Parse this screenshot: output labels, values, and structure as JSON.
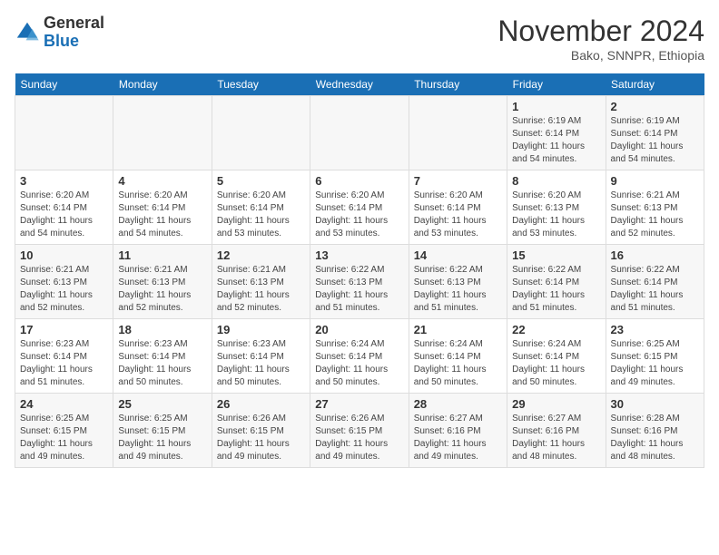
{
  "header": {
    "logo_line1": "General",
    "logo_line2": "Blue",
    "month": "November 2024",
    "location": "Bako, SNNPR, Ethiopia"
  },
  "weekdays": [
    "Sunday",
    "Monday",
    "Tuesday",
    "Wednesday",
    "Thursday",
    "Friday",
    "Saturday"
  ],
  "weeks": [
    [
      {
        "day": "",
        "info": ""
      },
      {
        "day": "",
        "info": ""
      },
      {
        "day": "",
        "info": ""
      },
      {
        "day": "",
        "info": ""
      },
      {
        "day": "",
        "info": ""
      },
      {
        "day": "1",
        "info": "Sunrise: 6:19 AM\nSunset: 6:14 PM\nDaylight: 11 hours\nand 54 minutes."
      },
      {
        "day": "2",
        "info": "Sunrise: 6:19 AM\nSunset: 6:14 PM\nDaylight: 11 hours\nand 54 minutes."
      }
    ],
    [
      {
        "day": "3",
        "info": "Sunrise: 6:20 AM\nSunset: 6:14 PM\nDaylight: 11 hours\nand 54 minutes."
      },
      {
        "day": "4",
        "info": "Sunrise: 6:20 AM\nSunset: 6:14 PM\nDaylight: 11 hours\nand 54 minutes."
      },
      {
        "day": "5",
        "info": "Sunrise: 6:20 AM\nSunset: 6:14 PM\nDaylight: 11 hours\nand 53 minutes."
      },
      {
        "day": "6",
        "info": "Sunrise: 6:20 AM\nSunset: 6:14 PM\nDaylight: 11 hours\nand 53 minutes."
      },
      {
        "day": "7",
        "info": "Sunrise: 6:20 AM\nSunset: 6:14 PM\nDaylight: 11 hours\nand 53 minutes."
      },
      {
        "day": "8",
        "info": "Sunrise: 6:20 AM\nSunset: 6:13 PM\nDaylight: 11 hours\nand 53 minutes."
      },
      {
        "day": "9",
        "info": "Sunrise: 6:21 AM\nSunset: 6:13 PM\nDaylight: 11 hours\nand 52 minutes."
      }
    ],
    [
      {
        "day": "10",
        "info": "Sunrise: 6:21 AM\nSunset: 6:13 PM\nDaylight: 11 hours\nand 52 minutes."
      },
      {
        "day": "11",
        "info": "Sunrise: 6:21 AM\nSunset: 6:13 PM\nDaylight: 11 hours\nand 52 minutes."
      },
      {
        "day": "12",
        "info": "Sunrise: 6:21 AM\nSunset: 6:13 PM\nDaylight: 11 hours\nand 52 minutes."
      },
      {
        "day": "13",
        "info": "Sunrise: 6:22 AM\nSunset: 6:13 PM\nDaylight: 11 hours\nand 51 minutes."
      },
      {
        "day": "14",
        "info": "Sunrise: 6:22 AM\nSunset: 6:13 PM\nDaylight: 11 hours\nand 51 minutes."
      },
      {
        "day": "15",
        "info": "Sunrise: 6:22 AM\nSunset: 6:14 PM\nDaylight: 11 hours\nand 51 minutes."
      },
      {
        "day": "16",
        "info": "Sunrise: 6:22 AM\nSunset: 6:14 PM\nDaylight: 11 hours\nand 51 minutes."
      }
    ],
    [
      {
        "day": "17",
        "info": "Sunrise: 6:23 AM\nSunset: 6:14 PM\nDaylight: 11 hours\nand 51 minutes."
      },
      {
        "day": "18",
        "info": "Sunrise: 6:23 AM\nSunset: 6:14 PM\nDaylight: 11 hours\nand 50 minutes."
      },
      {
        "day": "19",
        "info": "Sunrise: 6:23 AM\nSunset: 6:14 PM\nDaylight: 11 hours\nand 50 minutes."
      },
      {
        "day": "20",
        "info": "Sunrise: 6:24 AM\nSunset: 6:14 PM\nDaylight: 11 hours\nand 50 minutes."
      },
      {
        "day": "21",
        "info": "Sunrise: 6:24 AM\nSunset: 6:14 PM\nDaylight: 11 hours\nand 50 minutes."
      },
      {
        "day": "22",
        "info": "Sunrise: 6:24 AM\nSunset: 6:14 PM\nDaylight: 11 hours\nand 50 minutes."
      },
      {
        "day": "23",
        "info": "Sunrise: 6:25 AM\nSunset: 6:15 PM\nDaylight: 11 hours\nand 49 minutes."
      }
    ],
    [
      {
        "day": "24",
        "info": "Sunrise: 6:25 AM\nSunset: 6:15 PM\nDaylight: 11 hours\nand 49 minutes."
      },
      {
        "day": "25",
        "info": "Sunrise: 6:25 AM\nSunset: 6:15 PM\nDaylight: 11 hours\nand 49 minutes."
      },
      {
        "day": "26",
        "info": "Sunrise: 6:26 AM\nSunset: 6:15 PM\nDaylight: 11 hours\nand 49 minutes."
      },
      {
        "day": "27",
        "info": "Sunrise: 6:26 AM\nSunset: 6:15 PM\nDaylight: 11 hours\nand 49 minutes."
      },
      {
        "day": "28",
        "info": "Sunrise: 6:27 AM\nSunset: 6:16 PM\nDaylight: 11 hours\nand 49 minutes."
      },
      {
        "day": "29",
        "info": "Sunrise: 6:27 AM\nSunset: 6:16 PM\nDaylight: 11 hours\nand 48 minutes."
      },
      {
        "day": "30",
        "info": "Sunrise: 6:28 AM\nSunset: 6:16 PM\nDaylight: 11 hours\nand 48 minutes."
      }
    ]
  ]
}
